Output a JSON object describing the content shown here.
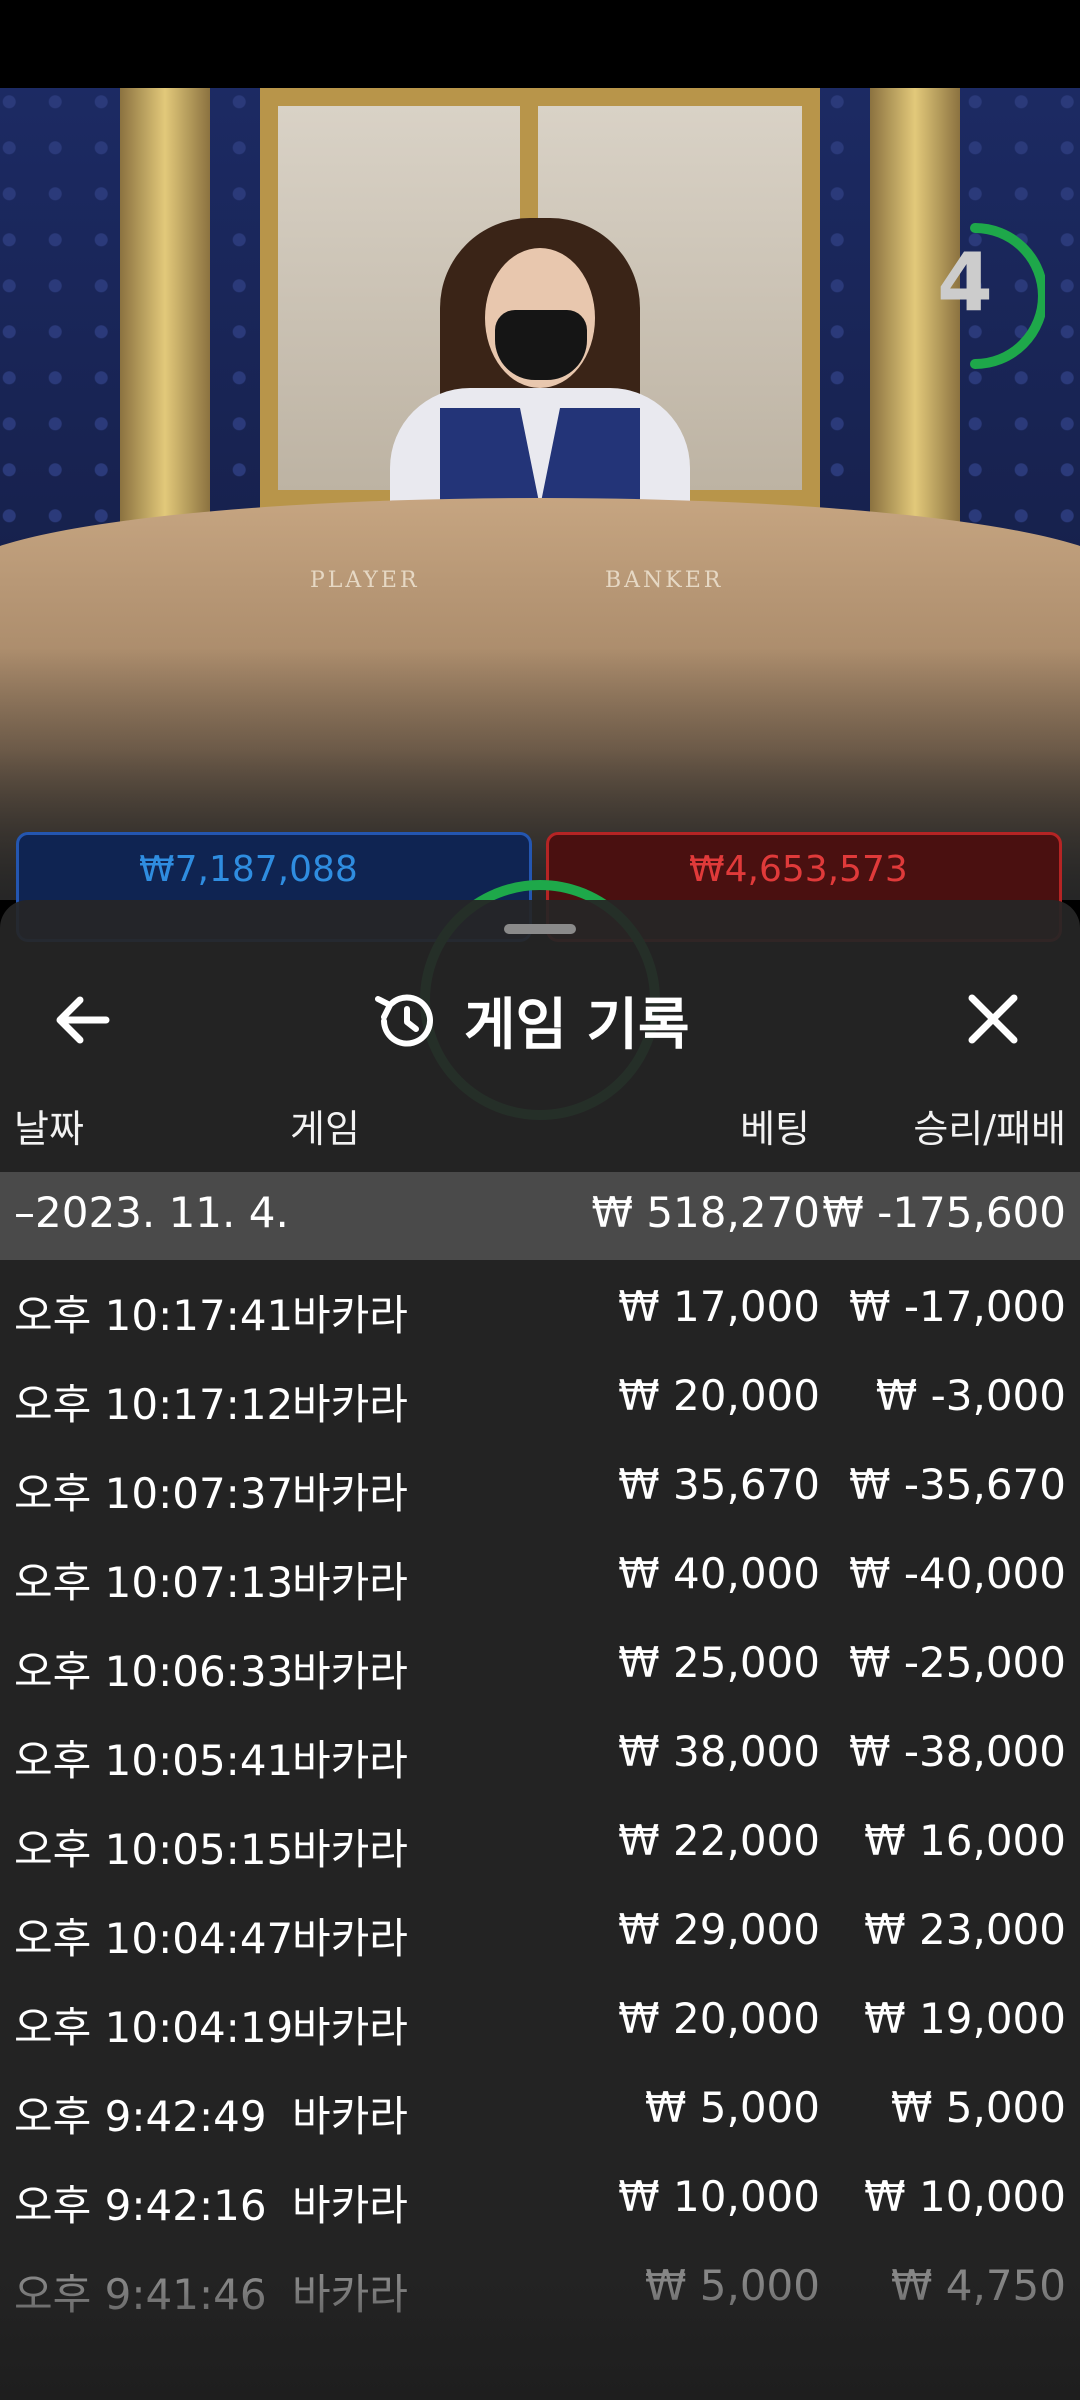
{
  "timer": {
    "value": "4",
    "color": "#1ea84a"
  },
  "table_labels": {
    "player": "PLAYER",
    "banker": "BANKER"
  },
  "underlay": {
    "player_total": "₩7,187,088",
    "banker_total": "₩4,653,573"
  },
  "sheet": {
    "title": "게임 기록",
    "title_icon": "history-icon",
    "back_icon": "arrow-left-icon",
    "close_icon": "close-icon",
    "columns": {
      "date": "날짜",
      "game": "게임",
      "bet": "베팅",
      "win_loss": "승리/패배"
    },
    "summary": {
      "date": "–2023. 11. 4.",
      "bet": "₩ 518,270",
      "win_loss": "₩ -175,600"
    },
    "rows": [
      {
        "time": "오후 10:17:41",
        "game": "바카라",
        "bet": "₩ 17,000",
        "win_loss": "₩ -17,000"
      },
      {
        "time": "오후 10:17:12",
        "game": "바카라",
        "bet": "₩ 20,000",
        "win_loss": "₩ -3,000"
      },
      {
        "time": "오후 10:07:37",
        "game": "바카라",
        "bet": "₩ 35,670",
        "win_loss": "₩ -35,670"
      },
      {
        "time": "오후 10:07:13",
        "game": "바카라",
        "bet": "₩ 40,000",
        "win_loss": "₩ -40,000"
      },
      {
        "time": "오후 10:06:33",
        "game": "바카라",
        "bet": "₩ 25,000",
        "win_loss": "₩ -25,000"
      },
      {
        "time": "오후 10:05:41",
        "game": "바카라",
        "bet": "₩ 38,000",
        "win_loss": "₩ -38,000"
      },
      {
        "time": "오후 10:05:15",
        "game": "바카라",
        "bet": "₩ 22,000",
        "win_loss": "₩ 16,000"
      },
      {
        "time": "오후 10:04:47",
        "game": "바카라",
        "bet": "₩ 29,000",
        "win_loss": "₩ 23,000"
      },
      {
        "time": "오후 10:04:19",
        "game": "바카라",
        "bet": "₩ 20,000",
        "win_loss": "₩ 19,000"
      },
      {
        "time": "오후 9:42:49",
        "game": "바카라",
        "bet": "₩ 5,000",
        "win_loss": "₩ 5,000"
      },
      {
        "time": "오후 9:42:16",
        "game": "바카라",
        "bet": "₩ 10,000",
        "win_loss": "₩ 10,000"
      },
      {
        "time": "오후 9:41:46",
        "game": "바카라",
        "bet": "₩ 5,000",
        "win_loss": "₩ 4,750"
      }
    ]
  }
}
